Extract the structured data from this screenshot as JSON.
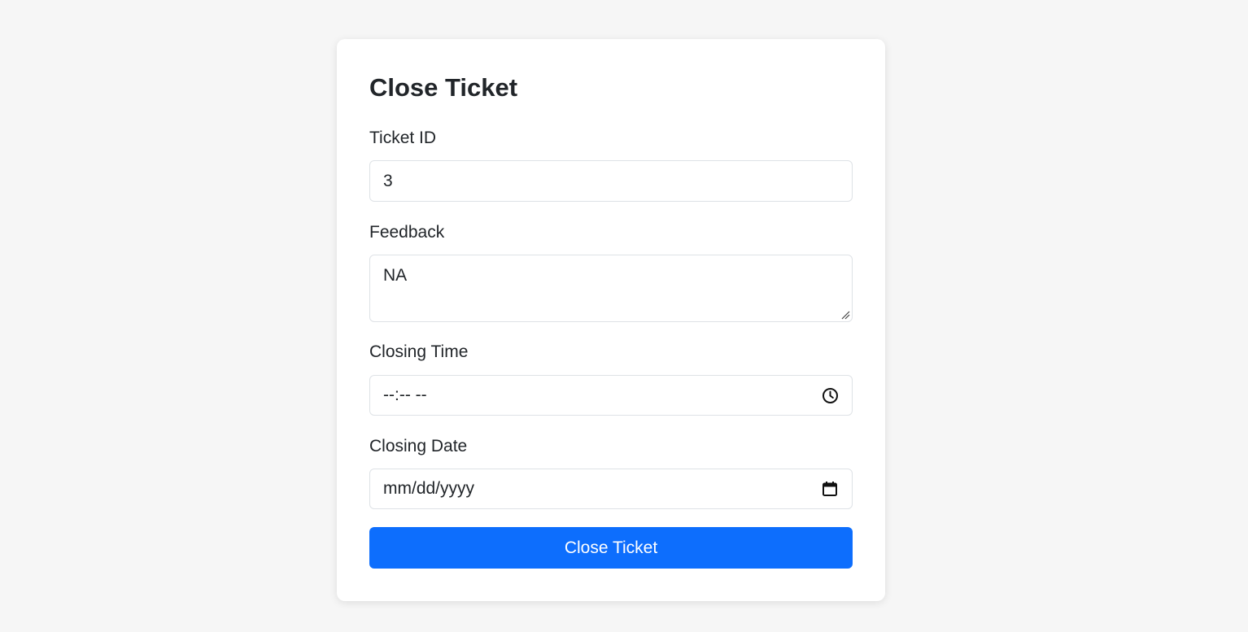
{
  "form": {
    "title": "Close Ticket",
    "ticket_id": {
      "label": "Ticket ID",
      "value": "3"
    },
    "feedback": {
      "label": "Feedback",
      "value": "NA"
    },
    "closing_time": {
      "label": "Closing Time",
      "value": "--:-- --",
      "icon": "clock-icon"
    },
    "closing_date": {
      "label": "Closing Date",
      "value": "mm/dd/yyyy",
      "icon": "calendar-icon"
    },
    "submit_label": "Close Ticket"
  },
  "colors": {
    "background": "#f6f6f6",
    "card": "#ffffff",
    "accent": "#0d6efd",
    "border": "#dee2e6",
    "text": "#212529"
  }
}
